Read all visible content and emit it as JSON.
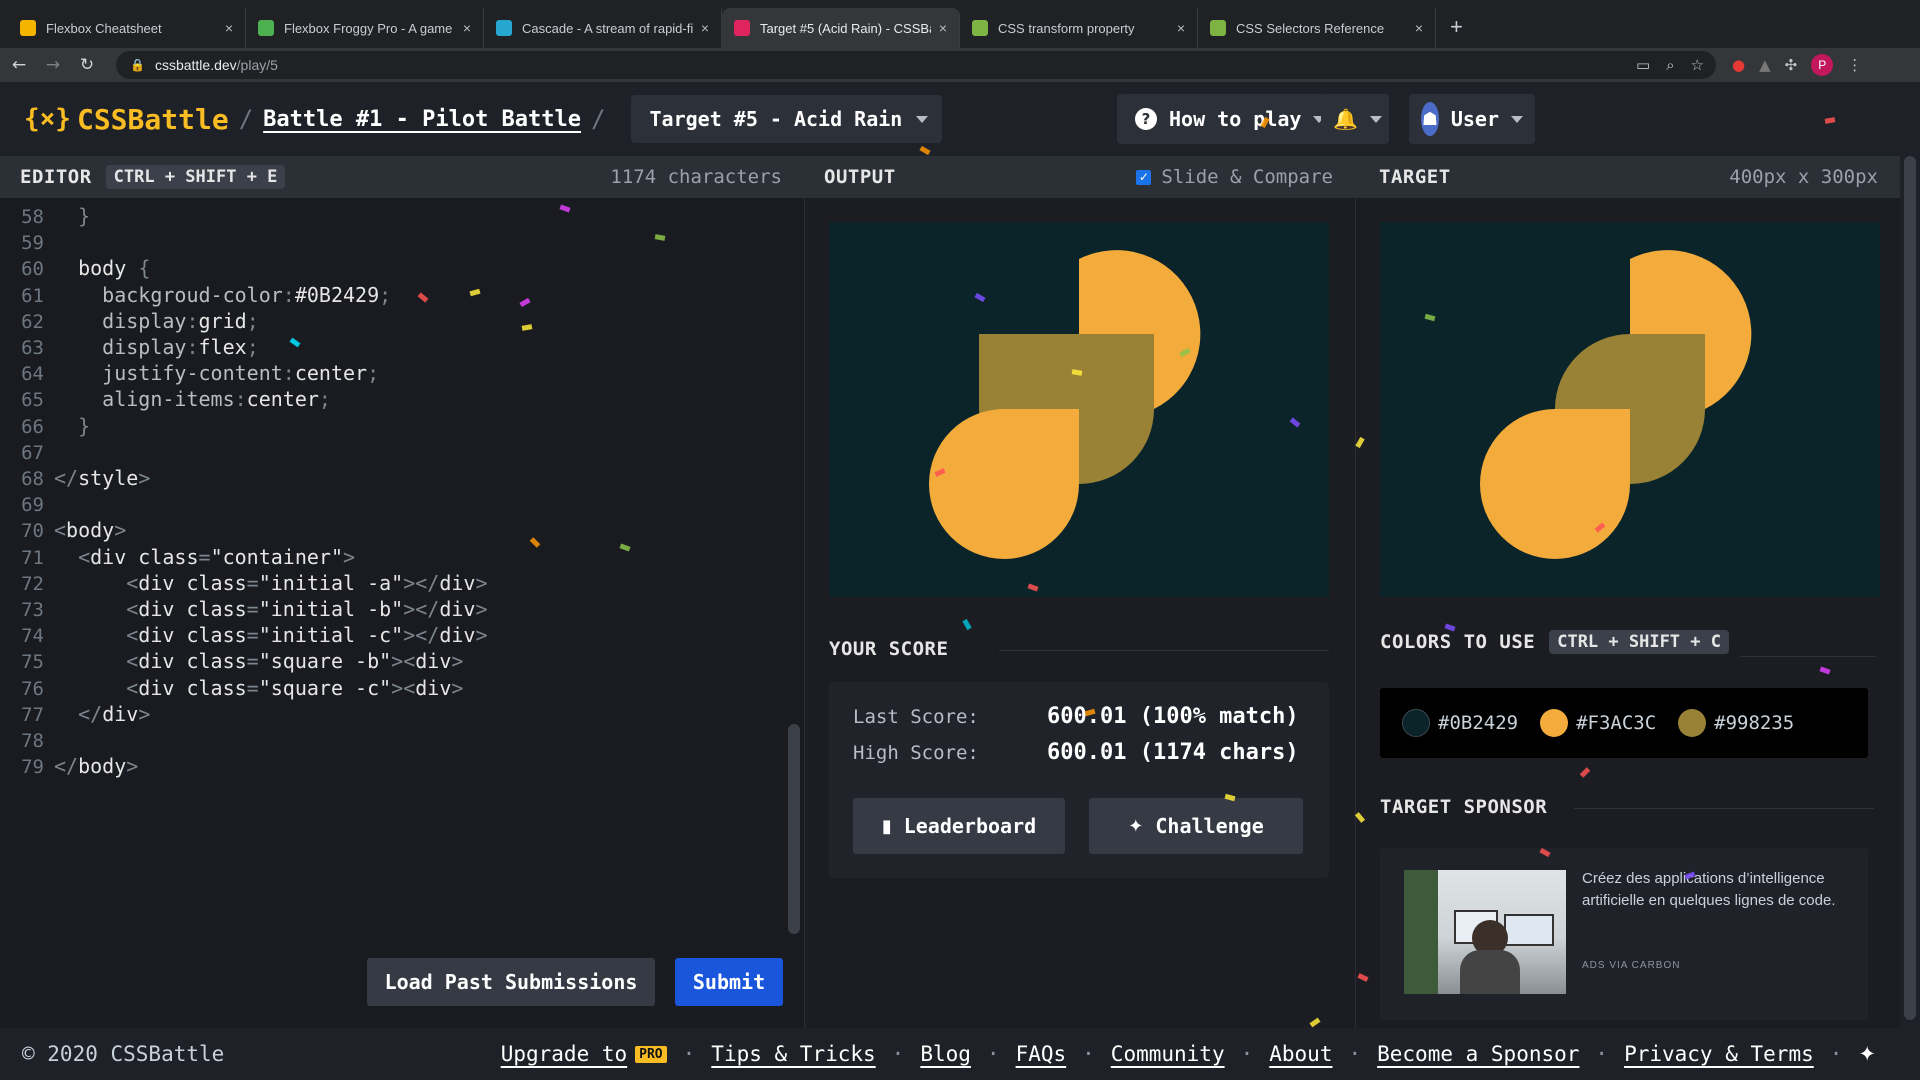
{
  "browser": {
    "tabs": [
      {
        "title": "Flexbox Cheatsheet",
        "favicon": "#f4b400"
      },
      {
        "title": "Flexbox Froggy Pro - A game f",
        "favicon": "#4caf50"
      },
      {
        "title": "Cascade - A stream of rapid-fi",
        "favicon": "#26a6d1"
      },
      {
        "title": "Target #5 (Acid Rain) - CSSBat",
        "favicon": "#e0245e",
        "active": true
      },
      {
        "title": "CSS transform property",
        "favicon": "#7cb342"
      },
      {
        "title": "CSS Selectors Reference",
        "favicon": "#7cb342"
      }
    ],
    "url_host": "cssbattle.dev",
    "url_path": "/play/5"
  },
  "header": {
    "logo": "CSSBattle",
    "logo_bracket": "{×}",
    "battle": "Battle #1 - Pilot Battle",
    "target_select": "Target #5 - Acid Rain",
    "how_to_play": "How to play",
    "user": "User"
  },
  "editor": {
    "label": "EDITOR",
    "shortcut": "CTRL + SHIFT + E",
    "char_count": "1174 characters",
    "load_past": "Load Past Submissions",
    "submit": "Submit"
  },
  "code_lines": [
    {
      "n": "58",
      "html": "  <span class='punct'>}</span>"
    },
    {
      "n": "59",
      "html": ""
    },
    {
      "n": "60",
      "html": "  <span class='tag'>body</span> <span class='punct'>{</span>"
    },
    {
      "n": "61",
      "html": "    <span class='prop'>backgroud-color</span><span class='punct'>:</span><span class='val'>#0B2429</span><span class='punct'>;</span>"
    },
    {
      "n": "62",
      "html": "    <span class='prop'>display</span><span class='punct'>:</span><span class='val'>grid</span><span class='punct'>;</span>"
    },
    {
      "n": "63",
      "html": "    <span class='prop'>display</span><span class='punct'>:</span><span class='val'>flex</span><span class='punct'>;</span>"
    },
    {
      "n": "64",
      "html": "    <span class='prop'>justify-content</span><span class='punct'>:</span><span class='val'>center</span><span class='punct'>;</span>"
    },
    {
      "n": "65",
      "html": "    <span class='prop'>align-items</span><span class='punct'>:</span><span class='val'>center</span><span class='punct'>;</span>"
    },
    {
      "n": "66",
      "html": "  <span class='punct'>}</span>"
    },
    {
      "n": "67",
      "html": ""
    },
    {
      "n": "68",
      "html": "<span class='punct'>&lt;/</span><span class='tag'>style</span><span class='punct'>&gt;</span>"
    },
    {
      "n": "69",
      "html": ""
    },
    {
      "n": "70",
      "html": "<span class='punct'>&lt;</span><span class='tag'>body</span><span class='punct'>&gt;</span>"
    },
    {
      "n": "71",
      "html": "  <span class='punct'>&lt;</span><span class='tag'>div class</span><span class='punct'>=</span><span class='str'>\"container\"</span><span class='punct'>&gt;</span>"
    },
    {
      "n": "72",
      "html": "      <span class='punct'>&lt;</span><span class='tag'>div class</span><span class='punct'>=</span><span class='str'>\"initial -a\"</span><span class='punct'>&gt;&lt;/</span><span class='tag'>div</span><span class='punct'>&gt;</span>"
    },
    {
      "n": "73",
      "html": "      <span class='punct'>&lt;</span><span class='tag'>div class</span><span class='punct'>=</span><span class='str'>\"initial -b\"</span><span class='punct'>&gt;&lt;/</span><span class='tag'>div</span><span class='punct'>&gt;</span>"
    },
    {
      "n": "74",
      "html": "      <span class='punct'>&lt;</span><span class='tag'>div class</span><span class='punct'>=</span><span class='str'>\"initial -c\"</span><span class='punct'>&gt;&lt;/</span><span class='tag'>div</span><span class='punct'>&gt;</span>"
    },
    {
      "n": "75",
      "html": "      <span class='punct'>&lt;</span><span class='tag'>div class</span><span class='punct'>=</span><span class='str'>\"square -b\"</span><span class='punct'>&gt;&lt;</span><span class='tag'>div</span><span class='punct'>&gt;</span>"
    },
    {
      "n": "76",
      "html": "      <span class='punct'>&lt;</span><span class='tag'>div class</span><span class='punct'>=</span><span class='str'>\"square -c\"</span><span class='punct'>&gt;&lt;</span><span class='tag'>div</span><span class='punct'>&gt;</span>"
    },
    {
      "n": "77",
      "html": "  <span class='punct'>&lt;/</span><span class='tag'>div</span><span class='punct'>&gt;</span>"
    },
    {
      "n": "78",
      "html": ""
    },
    {
      "n": "79",
      "html": "<span class='punct'>&lt;/</span><span class='tag'>body</span><span class='punct'>&gt;</span>"
    }
  ],
  "output": {
    "label": "OUTPUT",
    "slide_compare": "Slide & Compare",
    "your_score": "YOUR SCORE",
    "last_score_label": "Last Score:",
    "last_score": "600.01 (100% match)",
    "high_score_label": "High Score:",
    "high_score": "600.01 (1174 chars)",
    "leaderboard": "Leaderboard",
    "challenge": "Challenge"
  },
  "target": {
    "label": "TARGET",
    "size": "400px x 300px",
    "colors_title": "COLORS TO USE",
    "colors_shortcut": "CTRL + SHIFT + C",
    "colors": [
      {
        "hex": "#0B2429",
        "label": "#0B2429"
      },
      {
        "hex": "#F3AC3C",
        "label": "#F3AC3C"
      },
      {
        "hex": "#998235",
        "label": "#998235"
      }
    ],
    "sponsor_title": "TARGET SPONSOR",
    "sponsor_text": "Créez des applications d’intelligence artificielle en quelques lignes de code.",
    "ads_via": "ADS VIA CARBON"
  },
  "footer": {
    "copyright": "© 2020 CSSBattle",
    "links": [
      "Upgrade to",
      "Tips & Tricks",
      "Blog",
      "FAQs",
      "Community",
      "About",
      "Become a Sponsor",
      "Privacy & Terms"
    ],
    "pro_badge": "PRO"
  },
  "colors": {
    "accent": "#f9bc22",
    "submit": "#1a56db",
    "canvas": "#0B2429",
    "orange": "#F3AC3C",
    "olive": "#998235"
  }
}
